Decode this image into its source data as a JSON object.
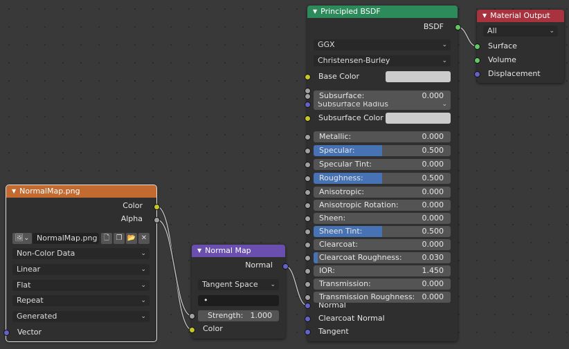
{
  "colors": {
    "bsdf_header": "#2d8a5a",
    "output_header": "#a8323d",
    "image_header": "#c26a2f",
    "normalmap_header": "#6a4fae",
    "slider_fill": "#4772b3"
  },
  "principled": {
    "title": "Principled BSDF",
    "output_label": "BSDF",
    "distribution": "GGX",
    "subsurface_method": "Christensen-Burley",
    "base_color_label": "Base Color",
    "subsurface_radius_label": "Subsurface Radius",
    "subsurface_color_label": "Subsurface Color",
    "fields": [
      {
        "label": "Subsurface:",
        "value": "0.000",
        "fill": 0
      },
      {
        "label": "Metallic:",
        "value": "0.000",
        "fill": 0
      },
      {
        "label": "Specular:",
        "value": "0.500",
        "fill": 0.5
      },
      {
        "label": "Specular Tint:",
        "value": "0.000",
        "fill": 0
      },
      {
        "label": "Roughness:",
        "value": "0.500",
        "fill": 0.5
      },
      {
        "label": "Anisotropic:",
        "value": "0.000",
        "fill": 0
      },
      {
        "label": "Anisotropic Rotation:",
        "value": "0.000",
        "fill": 0
      },
      {
        "label": "Sheen:",
        "value": "0.000",
        "fill": 0
      },
      {
        "label": "Sheen Tint:",
        "value": "0.500",
        "fill": 0.5
      },
      {
        "label": "Clearcoat:",
        "value": "0.000",
        "fill": 0
      },
      {
        "label": "Clearcoat Roughness:",
        "value": "0.030",
        "fill": 0.03
      },
      {
        "label": "IOR:",
        "value": "1.450",
        "fill": 0
      },
      {
        "label": "Transmission:",
        "value": "0.000",
        "fill": 0
      },
      {
        "label": "Transmission Roughness:",
        "value": "0.000",
        "fill": 0
      }
    ],
    "normal_label": "Normal",
    "clearcoat_normal_label": "Clearcoat Normal",
    "tangent_label": "Tangent"
  },
  "output": {
    "title": "Material Output",
    "target": "All",
    "surface": "Surface",
    "volume": "Volume",
    "displacement": "Displacement"
  },
  "image": {
    "title": "NormalMap.png",
    "color_out": "Color",
    "alpha_out": "Alpha",
    "image_name": "NormalMap.png",
    "colorspace": "Non-Color Data",
    "interpolation": "Linear",
    "projection": "Flat",
    "extension": "Repeat",
    "source": "Generated",
    "vector_in": "Vector"
  },
  "normalmap": {
    "title": "Normal Map",
    "normal_out": "Normal",
    "space": "Tangent Space",
    "uvmap": "•",
    "strength_label": "Strength:",
    "strength_value": "1.000",
    "color_in": "Color"
  }
}
